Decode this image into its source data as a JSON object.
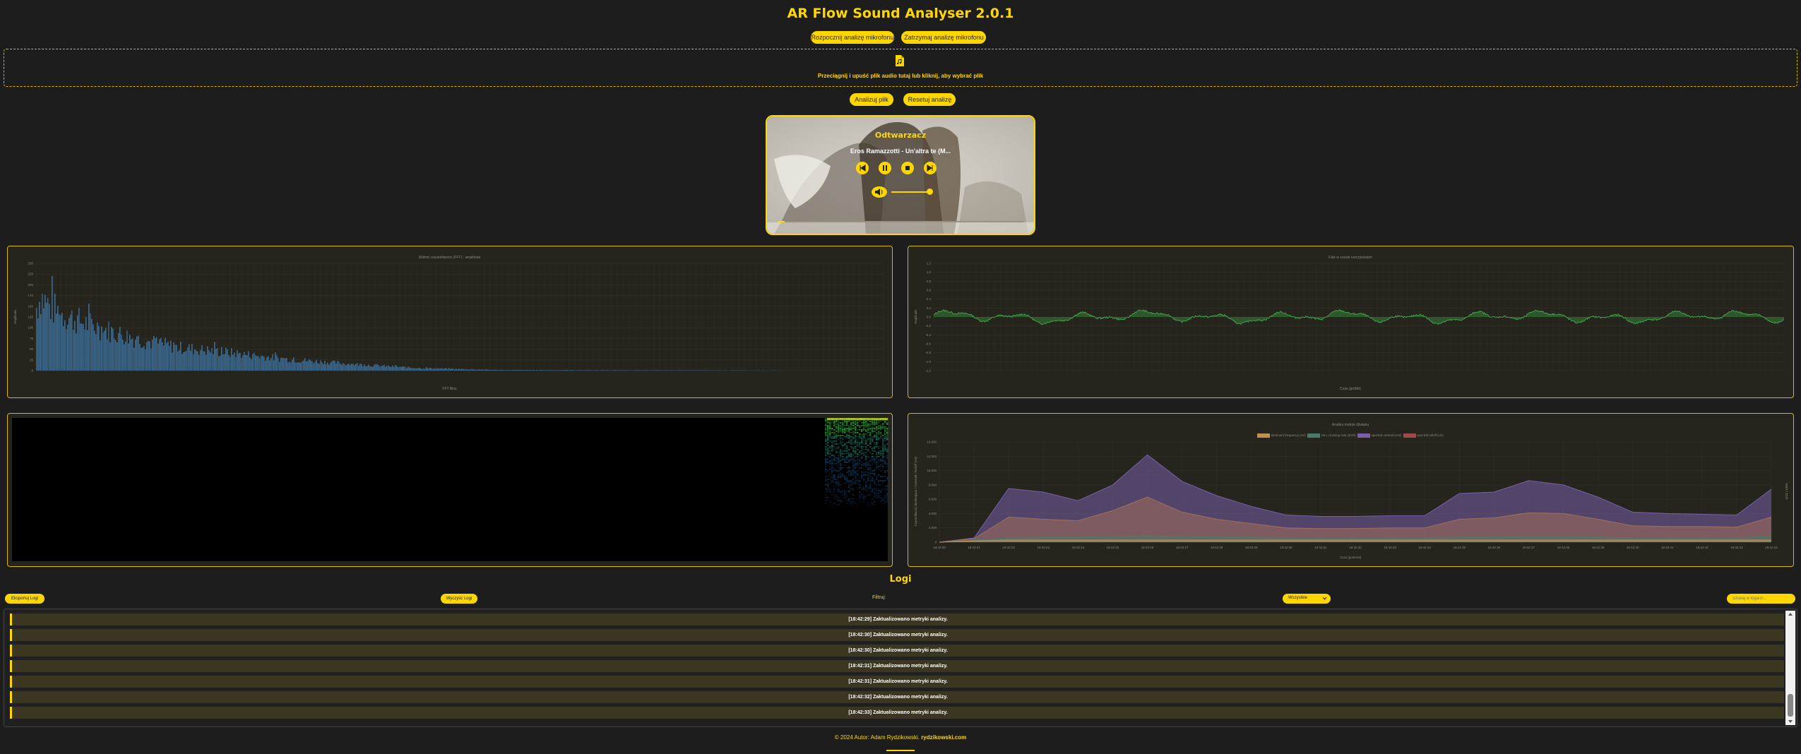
{
  "app_title": "AR Flow Sound Analyser 2.0.1",
  "mic": {
    "start_label": "Rozpocznij analizę mikrofonu",
    "stop_label": "Zatrzymaj analizę mikrofonu"
  },
  "dropzone": {
    "text": "Przeciągnij i upuść plik audio tutaj lub kliknij, aby wybrać plik",
    "icon": "file-audio-icon"
  },
  "actions": {
    "analyze_label": "Analizuj plik",
    "reset_label": "Resetuj analizę"
  },
  "player": {
    "title": "Odtwarzacz",
    "track": "Eros Ramazzotti - Un'altra te (M...",
    "buttons": [
      "prev-icon",
      "pause-icon",
      "stop-icon",
      "next-icon"
    ],
    "volume_icon": "volume-icon"
  },
  "fft_chart": {
    "title": "Widmo częstotliwości (FFT) - amplituda",
    "xlabel": "FFT Bins",
    "ylabel": "Amplituda"
  },
  "wave_chart": {
    "title": "Fale w czasie rzeczywistym",
    "xlabel": "Czas (próbki)",
    "ylabel": "Amplituda"
  },
  "metrics_chart": {
    "title": "Analiza metryk dźwięku",
    "xlabel": "Czas (godzina)",
    "ylabel_left": "Częstotliwość dominująca / Centroid / Rolloff (Hz)",
    "ylabel_right": "RMS / ZCR",
    "legend": [
      "dominant frequency (Hz)",
      "zero crossing rate (ZCR)",
      "spectral centroid (Hz)",
      "spectral rolloff (Hz)"
    ]
  },
  "chart_data": [
    {
      "type": "bar",
      "title": "Widmo częstotliwości (FFT) - amplituda",
      "xlabel": "FFT Bins",
      "ylabel": "Amplituda",
      "ylim": [
        0,
        250
      ],
      "yticks": [
        0,
        25,
        50,
        75,
        100,
        125,
        150,
        175,
        200,
        225,
        250
      ],
      "series_color": "#2f6fa8",
      "envelope": [
        {
          "bin": 0,
          "value": 190
        },
        {
          "bin": 5,
          "value": 225
        },
        {
          "bin": 15,
          "value": 195
        },
        {
          "bin": 30,
          "value": 170
        },
        {
          "bin": 50,
          "value": 150
        },
        {
          "bin": 80,
          "value": 125
        },
        {
          "bin": 120,
          "value": 95
        },
        {
          "bin": 170,
          "value": 70
        },
        {
          "bin": 230,
          "value": 55
        },
        {
          "bin": 300,
          "value": 35
        },
        {
          "bin": 380,
          "value": 20
        },
        {
          "bin": 460,
          "value": 8
        },
        {
          "bin": 560,
          "value": 2
        },
        {
          "bin": 1024,
          "value": 0
        }
      ]
    },
    {
      "type": "line",
      "title": "Fale w czasie rzeczywistym",
      "xlabel": "Czas (próbki)",
      "ylabel": "Amplituda",
      "ylim": [
        -1.2,
        1.2
      ],
      "yticks": [
        -1.2,
        -1.0,
        -0.8,
        -0.6,
        -0.4,
        -0.2,
        0,
        0.2,
        0.4,
        0.6,
        0.8,
        1.0,
        1.2
      ],
      "series_color": "#3fae49"
    },
    {
      "type": "area",
      "title": "Analiza metryk dźwięku",
      "x": [
        "18:42:20",
        "18:42:21",
        "18:42:22",
        "18:42:23",
        "18:42:24",
        "18:42:25",
        "18:42:26",
        "18:42:27",
        "18:42:28",
        "18:42:29",
        "18:42:30",
        "18:42:31",
        "18:42:32",
        "18:42:33",
        "18:42:34",
        "18:42:35",
        "18:42:36",
        "18:42:37",
        "18:42:38",
        "18:42:39",
        "18:42:40",
        "18:42:41",
        "18:42:42",
        "18:42:43",
        "18:42:44"
      ],
      "ylim_left": [
        0,
        14000
      ],
      "yticks_left": [
        0,
        2000,
        4000,
        6000,
        8000,
        10000,
        12000,
        14000
      ],
      "series": [
        {
          "name": "spectral rolloff (Hz)",
          "color": "#7a5ea8",
          "values": [
            0,
            600,
            7500,
            7000,
            5800,
            8000,
            12200,
            8500,
            6500,
            5000,
            3800,
            3600,
            3600,
            3700,
            3700,
            6800,
            7000,
            8600,
            8000,
            6300,
            4200,
            4000,
            3900,
            3800,
            7400
          ]
        },
        {
          "name": "spectral centroid (Hz)",
          "color": "#a0705a",
          "values": [
            0,
            500,
            3500,
            3200,
            3000,
            4400,
            6300,
            4200,
            3200,
            2600,
            2000,
            1900,
            1900,
            2000,
            2000,
            3200,
            3400,
            4100,
            4000,
            3200,
            2300,
            2200,
            2200,
            2100,
            3500
          ]
        },
        {
          "name": "zero crossing rate (ZCR)",
          "color": "#4a7a6a",
          "values": [
            0,
            300,
            600,
            700,
            700,
            800,
            900,
            800,
            700,
            700,
            600,
            600,
            600,
            600,
            600,
            700,
            700,
            800,
            800,
            700,
            600,
            600,
            600,
            600,
            800
          ]
        },
        {
          "name": "dominant frequency (Hz)",
          "color": "#c09050",
          "values": [
            0,
            200,
            300,
            300,
            300,
            300,
            300,
            300,
            300,
            300,
            300,
            300,
            300,
            300,
            300,
            300,
            300,
            300,
            300,
            300,
            300,
            300,
            300,
            300,
            300
          ]
        }
      ]
    }
  ],
  "logs": {
    "title": "Logi",
    "export_label": "Eksportuj Logi",
    "clear_label": "Wyczyść Logi",
    "filter_label": "Filtruj:",
    "filter_value": "Wszystkie",
    "search_placeholder": "Szukaj w logach...",
    "entries": [
      "[18:42:29] Zaktualizowano metryki analizy.",
      "[18:42:30] Zaktualizowano metryki analizy.",
      "[18:42:30] Zaktualizowano metryki analizy.",
      "[18:42:31] Zaktualizowano metryki analizy.",
      "[18:42:31] Zaktualizowano metryki analizy.",
      "[18:42:32] Zaktualizowano metryki analizy.",
      "[18:42:33] Zaktualizowano metryki analizy."
    ]
  },
  "footer": {
    "text": "© 2024 Autor: Adam Rydzikowski.",
    "link": "rydzikowski.com"
  },
  "colors": {
    "accent": "#ffd700",
    "background": "#1d1d1d",
    "card": "#25251d"
  }
}
